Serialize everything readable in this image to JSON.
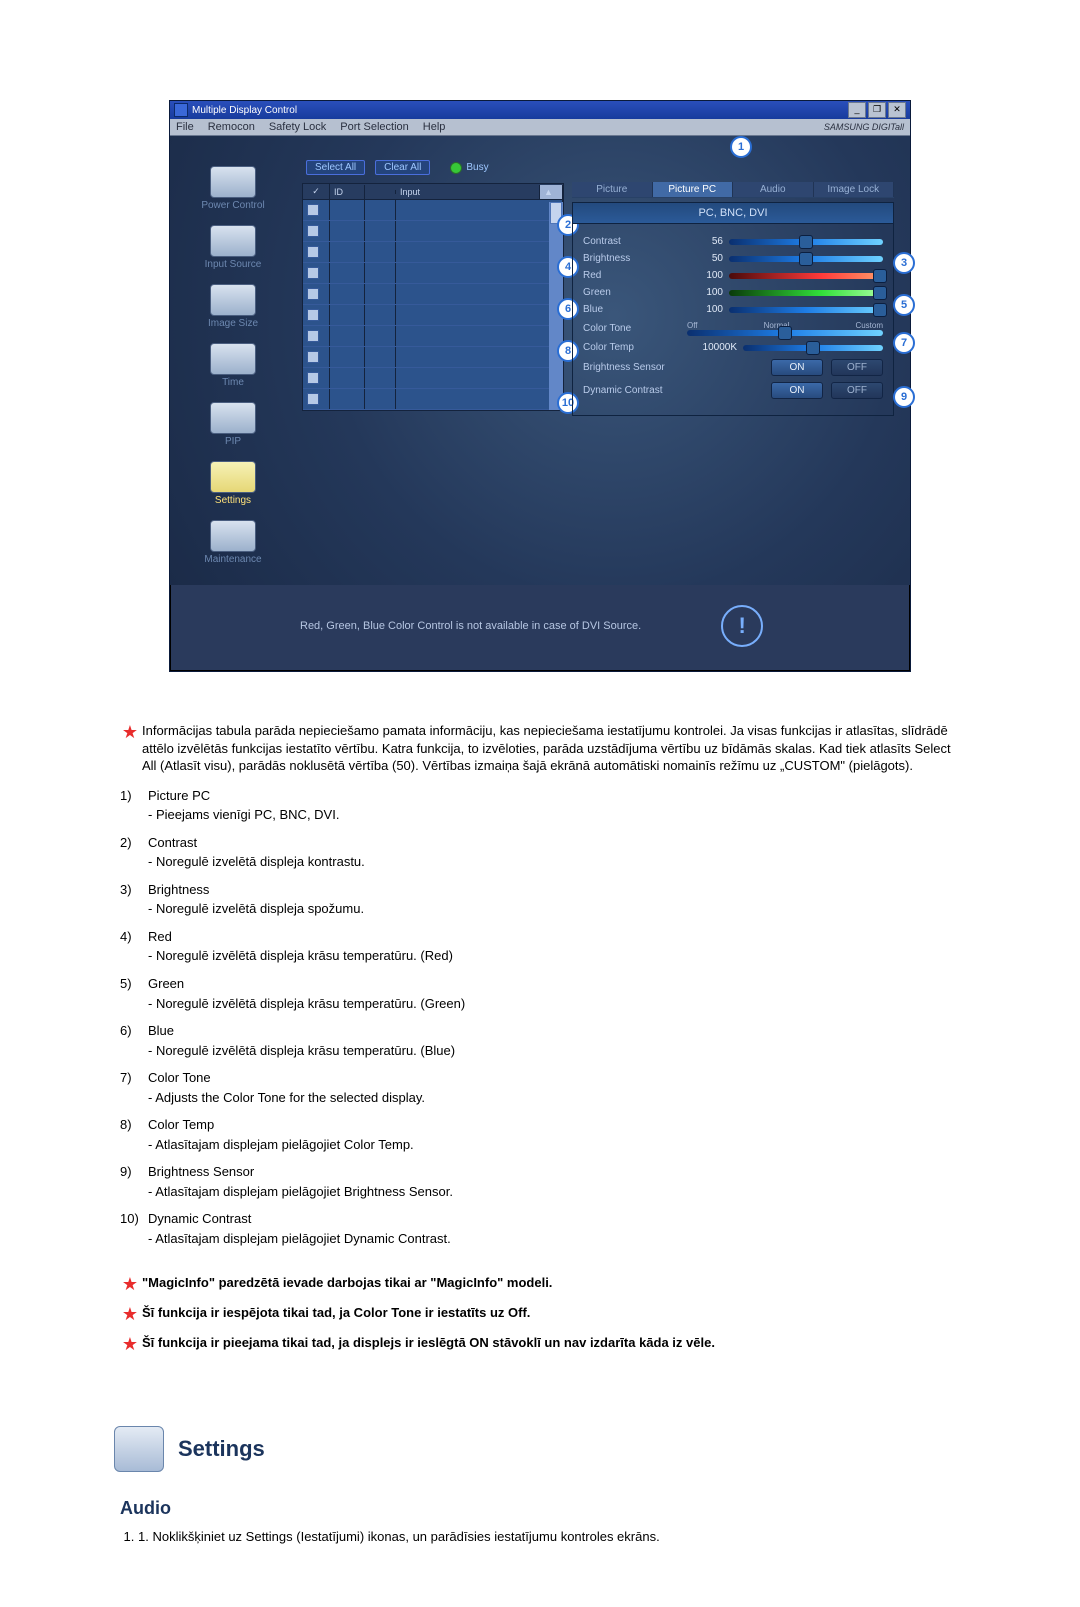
{
  "app": {
    "title": "Multiple Display Control",
    "brand": "SAMSUNG DIGITall",
    "menu": [
      "File",
      "Remocon",
      "Safety Lock",
      "Port Selection",
      "Help"
    ],
    "window_buttons": [
      "_",
      "❐",
      "✕"
    ],
    "sidebar": [
      {
        "key": "power",
        "label": "Power Control"
      },
      {
        "key": "input",
        "label": "Input Source"
      },
      {
        "key": "size",
        "label": "Image Size"
      },
      {
        "key": "time",
        "label": "Time"
      },
      {
        "key": "pip",
        "label": "PIP"
      },
      {
        "key": "set",
        "label": "Settings"
      },
      {
        "key": "maint",
        "label": "Maintenance"
      }
    ],
    "buttons": {
      "select_all": "Select All",
      "clear_all": "Clear All",
      "busy": "Busy"
    },
    "table_cols": {
      "check": "✓",
      "id": "ID",
      "status": "",
      "input": "Input"
    },
    "tabs": [
      "Picture",
      "Picture PC",
      "Audio",
      "Image Lock"
    ],
    "modes": "PC, BNC, DVI",
    "controls": {
      "contrast": {
        "label": "Contrast",
        "value": "56"
      },
      "brightness": {
        "label": "Brightness",
        "value": "50"
      },
      "red": {
        "label": "Red",
        "value": "100"
      },
      "green": {
        "label": "Green",
        "value": "100"
      },
      "blue": {
        "label": "Blue",
        "value": "100"
      },
      "color_tone": {
        "label": "Color Tone",
        "opts": [
          "Off",
          "Normal",
          "Custom"
        ]
      },
      "color_temp": {
        "label": "Color Temp",
        "value": "10000K"
      },
      "brightness_sensor": {
        "label": "Brightness Sensor",
        "on": "ON",
        "off": "OFF"
      },
      "dynamic_contrast": {
        "label": "Dynamic Contrast",
        "on": "ON",
        "off": "OFF"
      }
    },
    "footer_note": "Red, Green, Blue Color Control is not available in case of DVI Source.",
    "callouts_left": [
      "2",
      "4",
      "6",
      "8",
      "10"
    ],
    "callouts_right": [
      "3",
      "5",
      "7",
      "9"
    ],
    "callout_top": "1"
  },
  "intro_star": "Informācijas tabula parāda nepieciešamo pamata informāciju, kas nepieciešama iestatījumu kontrolei. Ja visas funkcijas ir atlasītas, slīdrādē attēlo izvēlētās funkcijas iestatīto vērtību. Katra funkcija, to izvēloties, parāda uzstādījuma vērtību uz bīdāmās skalas. Kad tiek atlasīts Select All (Atlasīt visu), parādās noklusētā vērtība (50). Vērtības izmaiņa šajā ekrānā automātiski nomainīs režīmu uz „CUSTOM\" (pielāgots).",
  "items": [
    {
      "n": "1)",
      "t": "Picture PC",
      "sub": "- Pieejams vienīgi PC, BNC, DVI."
    },
    {
      "n": "2)",
      "t": "Contrast",
      "sub": "- Noregulē izvelētā displeja kontrastu."
    },
    {
      "n": "3)",
      "t": "Brightness",
      "sub": "- Noregulē izvelētā displeja spožumu."
    },
    {
      "n": "4)",
      "t": "Red",
      "sub": "- Noregulē izvēlētā displeja krāsu temperatūru. (Red)"
    },
    {
      "n": "5)",
      "t": "Green",
      "sub": "- Noregulē izvēlētā displeja krāsu temperatūru. (Green)"
    },
    {
      "n": "6)",
      "t": "Blue",
      "sub": "- Noregulē izvēlētā displeja krāsu temperatūru. (Blue)"
    },
    {
      "n": "7)",
      "t": "Color Tone",
      "sub": "- Adjusts the Color Tone for the selected display."
    },
    {
      "n": "8)",
      "t": "Color Temp",
      "sub": "- Atlasītajam displejam pielāgojiet Color Temp."
    },
    {
      "n": "9)",
      "t": "Brightness Sensor",
      "sub": "- Atlasītajam displejam pielāgojiet Brightness Sensor."
    },
    {
      "n": "10)",
      "t": "Dynamic Contrast",
      "sub": "- Atlasītajam displejam pielāgojiet Dynamic Contrast."
    }
  ],
  "notes": [
    "\"MagicInfo\" paredzētā ievade darbojas tikai ar \"MagicInfo\" modeli.",
    "Šī funkcija ir iespējota tikai tad, ja Color Tone ir iestatīts uz Off.",
    "Šī funkcija ir pieejama tikai tad, ja displejs ir ieslēgtā ON stāvoklī un nav izdarīta kāda iz vēle."
  ],
  "section": {
    "title": "Settings",
    "sub_title": "Audio",
    "step1_num": "1.",
    "step1": "Noklikšķiniet uz Settings (Iestatījumi) ikonas, un parādīsies iestatījumu kontroles ekrāns."
  }
}
